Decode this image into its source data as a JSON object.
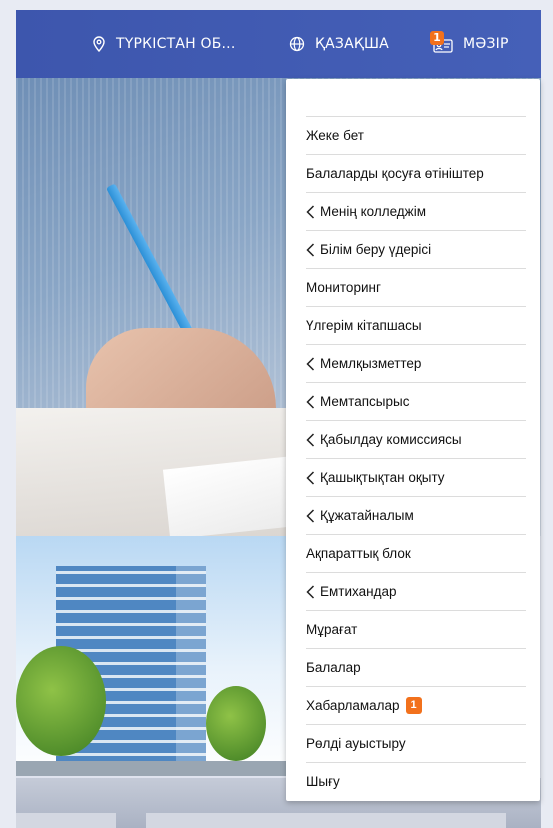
{
  "header": {
    "location_label": "ТҮРКІСТАН ОБ...",
    "language_label": "ҚАЗАҚША",
    "menu_label": "МӘЗІР",
    "menu_badge": "1",
    "icons": {
      "location": "location-pin-icon",
      "language": "globe-icon",
      "menu": "id-card-icon"
    }
  },
  "dropdown": {
    "items": [
      {
        "label": "Жеке бет",
        "submenu": false
      },
      {
        "label": "Балаларды қосуға өтініштер",
        "submenu": false
      },
      {
        "label": "Менің колледжім",
        "submenu": true
      },
      {
        "label": "Білім беру үдерісі",
        "submenu": true
      },
      {
        "label": "Мониторинг",
        "submenu": false
      },
      {
        "label": "Үлгерім кітапшасы",
        "submenu": false
      },
      {
        "label": "Мемлқызметтер",
        "submenu": true
      },
      {
        "label": "Мемтапсырыс",
        "submenu": true
      },
      {
        "label": "Қабылдау комиссиясы",
        "submenu": true
      },
      {
        "label": "Қашықтықтан оқыту",
        "submenu": true
      },
      {
        "label": "Құжатайналым",
        "submenu": true
      },
      {
        "label": "Ақпараттық блок",
        "submenu": false
      },
      {
        "label": "Емтихандар",
        "submenu": true
      },
      {
        "label": "Мұрағат",
        "submenu": false
      },
      {
        "label": "Балалар",
        "submenu": false
      },
      {
        "label": "Хабарламалар",
        "submenu": false,
        "badge": "1"
      },
      {
        "label": "Рөлді ауыстыру",
        "submenu": false
      },
      {
        "label": "Шығу",
        "submenu": false
      }
    ]
  },
  "colors": {
    "header_bg": "#4560b8",
    "badge": "#f2711c",
    "divider": "#dcdcdc"
  }
}
